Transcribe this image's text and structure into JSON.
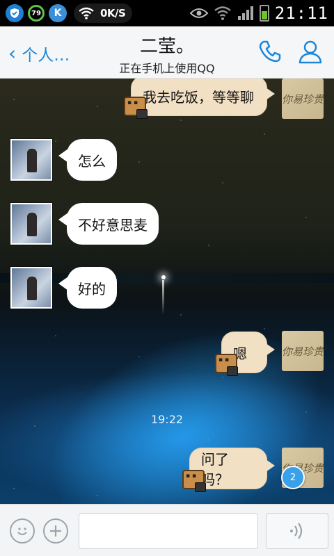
{
  "status_bar": {
    "ring_value": "79",
    "k_label": "K",
    "net_speed": "0K/S",
    "time": "21:11"
  },
  "header": {
    "back_label": "个人…",
    "contact_name": "二莹。",
    "contact_status": "正在手机上使用QQ"
  },
  "messages": [
    {
      "side": "right",
      "text": "我去吃饭，等等聊"
    },
    {
      "side": "left",
      "text": "怎么"
    },
    {
      "side": "left",
      "text": "不好意思麦"
    },
    {
      "side": "left",
      "text": "好的"
    },
    {
      "side": "right",
      "text": "嗯"
    },
    {
      "side": "right",
      "text": "问了吗？"
    }
  ],
  "my_avatar_text": "你易珍贵",
  "timestamp": "19:22",
  "unread_count": "2",
  "colors": {
    "accent": "#1b87da",
    "bubble_right": "#f2e0c4",
    "bubble_left": "#ffffff"
  },
  "icons": {
    "shield": "shield-icon",
    "phone": "phone-icon",
    "person": "person-icon",
    "emoji": "emoji-icon",
    "plus": "plus-icon",
    "voice": "voice-icon"
  }
}
